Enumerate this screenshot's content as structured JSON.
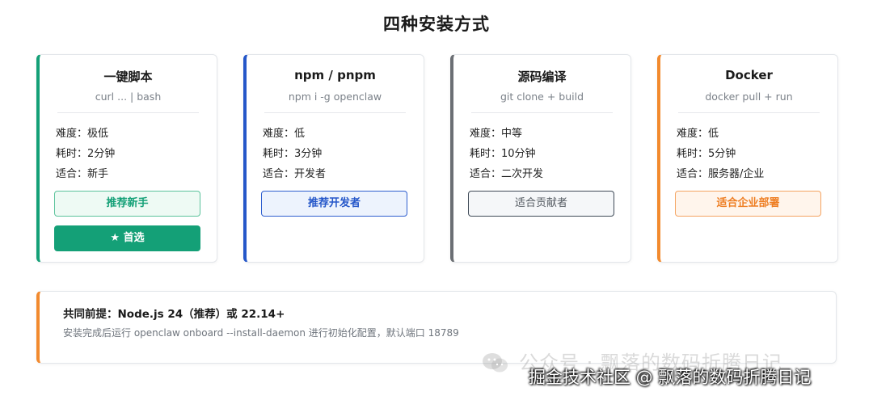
{
  "page": {
    "title": "四种安装方式"
  },
  "cards": [
    {
      "title": "一键脚本",
      "command": "curl ... | bash",
      "difficulty": "难度：极低",
      "time": "耗时：2分钟",
      "suitable": "适合：新手",
      "tag_label": "推荐新手",
      "primary_label": "★ 首选",
      "accent_color": "#14a077"
    },
    {
      "title": "npm / pnpm",
      "command": "npm i -g openclaw",
      "difficulty": "难度：低",
      "time": "耗时：3分钟",
      "suitable": "适合：开发者",
      "tag_label": "推荐开发者",
      "accent_color": "#2557c9"
    },
    {
      "title": "源码编译",
      "command": "git clone + build",
      "difficulty": "难度：中等",
      "time": "耗时：10分钟",
      "suitable": "适合：二次开发",
      "tag_label": "适合贡献者",
      "accent_color": "#6b6f74"
    },
    {
      "title": "Docker",
      "command": "docker pull + run",
      "difficulty": "难度：低",
      "time": "耗时：5分钟",
      "suitable": "适合：服务器/企业",
      "tag_label": "适合企业部署",
      "accent_color": "#f28a2e"
    }
  ],
  "prerequisite": {
    "title": "共同前提：Node.js 24（推荐）或 22.14+",
    "description": "安装完成后运行 openclaw onboard --install-daemon 进行初始化配置，默认端口 18789",
    "accent_color": "#f28a2e"
  },
  "watermark": {
    "wechat_text": "公众号 · 飘落的数码折腾日记",
    "juejin_text": "掘金技术社区 @ 飘落的数码折腾日记",
    "icon": "wechat-icon"
  }
}
